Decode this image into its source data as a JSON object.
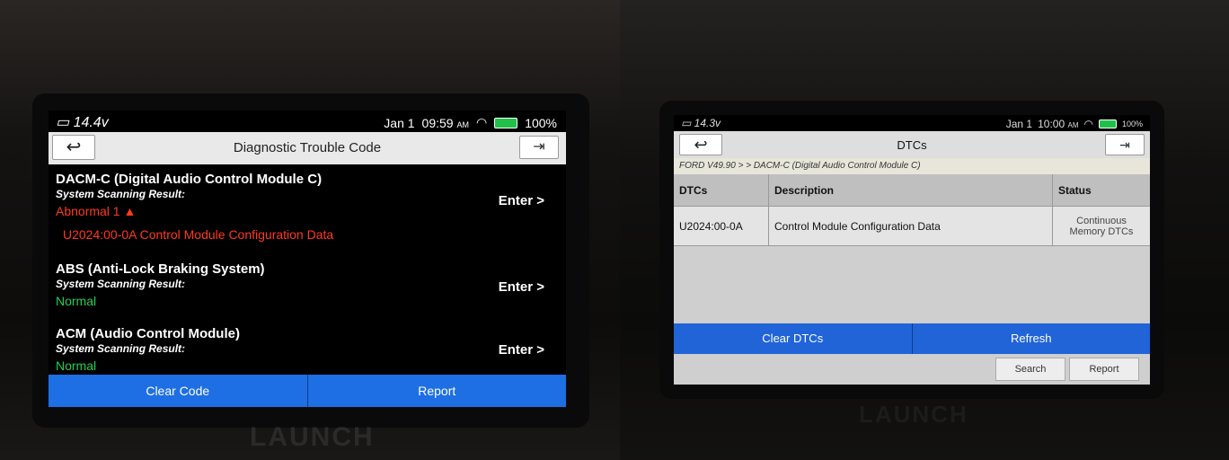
{
  "left": {
    "brand": "LAUNCH",
    "status": {
      "voltage": "14.4v",
      "date": "Jan 1",
      "time": "09:59",
      "ampm": "AM",
      "battery": "100%"
    },
    "title": "Diagnostic Trouble Code",
    "systems": [
      {
        "name": "DACM-C (Digital Audio Control Module C)",
        "label": "System Scanning Result:",
        "result": "Abnormal 1",
        "dtc": "U2024:00-0A Control Module Configuration Data",
        "enter": "Enter >"
      },
      {
        "name": "ABS (Anti-Lock Braking System)",
        "label": "System Scanning Result:",
        "result": "Normal",
        "enter": "Enter >"
      },
      {
        "name": "ACM (Audio Control Module)",
        "label": "System Scanning Result:",
        "result": "Normal",
        "enter": "Enter >"
      }
    ],
    "buttons": {
      "clear": "Clear Code",
      "report": "Report"
    }
  },
  "right": {
    "brand": "LAUNCH",
    "status": {
      "voltage": "14.3v",
      "date": "Jan 1",
      "time": "10:00",
      "ampm": "AM",
      "battery": "100%"
    },
    "title": "DTCs",
    "breadcrumb": "FORD V49.90 > > DACM-C (Digital Audio Control Module C)",
    "columns": [
      "DTCs",
      "Description",
      "Status"
    ],
    "rows": [
      {
        "code": "U2024:00-0A",
        "description": "Control Module Configuration Data",
        "status": "Continuous Memory DTCs"
      }
    ],
    "buttons": {
      "clear": "Clear DTCs",
      "refresh": "Refresh",
      "search": "Search",
      "report": "Report"
    }
  },
  "colors": {
    "accent_blue": "#1e6fe3",
    "fault_red": "#ff3b1c",
    "ok_green": "#23d050"
  }
}
